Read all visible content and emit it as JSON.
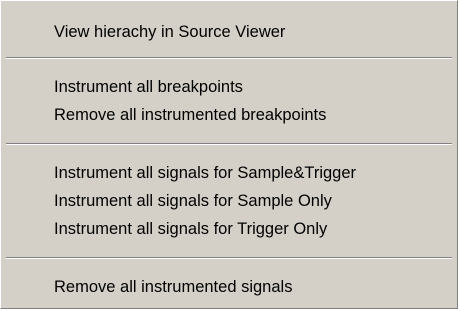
{
  "menu": {
    "items": [
      {
        "label": "View hierachy in Source Viewer"
      },
      {
        "label": "Instrument all breakpoints"
      },
      {
        "label": "Remove all instrumented breakpoints"
      },
      {
        "label": "Instrument all signals for Sample&Trigger"
      },
      {
        "label": "Instrument all signals for Sample Only"
      },
      {
        "label": "Instrument all signals for Trigger Only"
      },
      {
        "label": "Remove all instrumented signals"
      }
    ]
  }
}
